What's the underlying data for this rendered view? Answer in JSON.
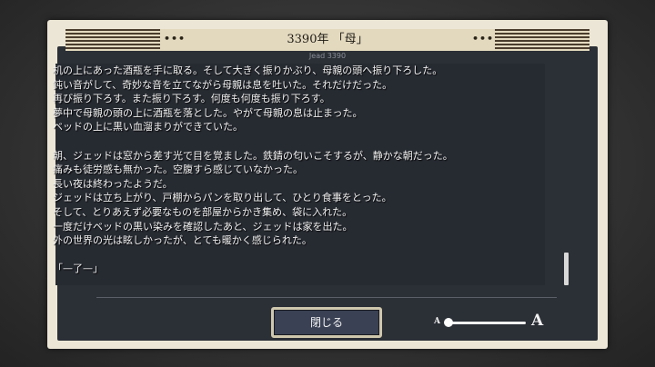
{
  "header": {
    "title": "3390年 「母」",
    "left_dots": "•••",
    "right_dots": "•••",
    "subtitle": "Jead 3390"
  },
  "story": {
    "lines": [
      "机の上にあった酒瓶を手に取る。そして大きく振りかぶり、母親の頭へ振り下ろした。",
      "鈍い音がして、奇妙な音を立てながら母親は息を吐いた。それだけだった。",
      "再び振り下ろす。また振り下ろす。何度も何度も振り下ろす。",
      "夢中で母親の頭の上に酒瓶を落とした。やがて母親の息は止まった。",
      "ベッドの上に黒い血溜まりができていた。",
      "",
      "朝、ジェッドは窓から差す光で目を覚ました。鉄錆の匂いこそするが、静かな朝だった。",
      "痛みも徒労感も無かった。空腹すら感じていなかった。",
      "長い夜は終わったようだ。",
      "ジェッドは立ち上がり、戸棚からパンを取り出して、ひとり食事をとった。",
      "そして、とりあえず必要なものを部屋からかき集め、袋に入れた。",
      "一度だけベッドの黒い染みを確認したあと、ジェッドは家を出た。",
      "外の世界の光は眩しかったが、とても暖かく感じられた。",
      "",
      "「—了—」"
    ]
  },
  "footer": {
    "close_label": "閉じる",
    "font_small_label": "A",
    "font_large_label": "A",
    "font_size_level": 0
  },
  "colors": {
    "frame": "#ece6d6",
    "panel": "#2b2f36",
    "button": "#3a4154",
    "button_border": "#cfc7ae",
    "text": "#f2f2f2"
  }
}
